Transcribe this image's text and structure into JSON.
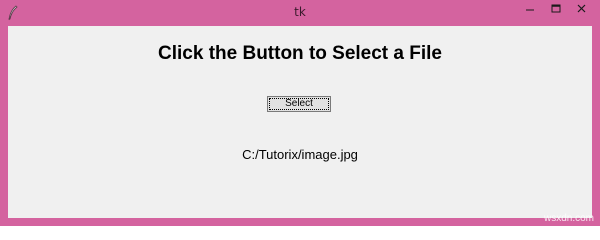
{
  "window": {
    "title": "tk",
    "frame_color": "#d4639f",
    "client_bg": "#f0f0f0"
  },
  "content": {
    "heading": "Click the Button to Select a File",
    "select_button_label": "Select",
    "selected_path": "C:/Tutorix/image.jpg"
  },
  "watermark": "wsxdn.com",
  "icons": {
    "app": "feather-icon",
    "minimize": "minimize-icon",
    "maximize": "maximize-icon",
    "close": "close-icon"
  }
}
